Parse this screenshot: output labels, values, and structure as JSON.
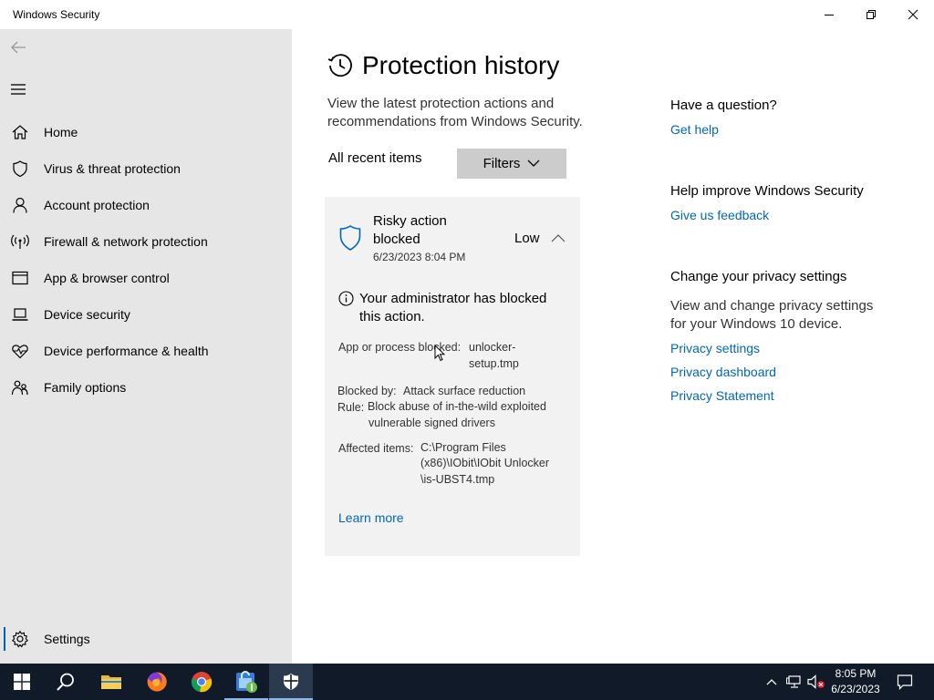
{
  "window": {
    "title": "Windows Security",
    "controls": [
      "minimize",
      "restore",
      "close"
    ]
  },
  "sidebar": {
    "items": [
      {
        "label": "Home",
        "icon": "home-icon"
      },
      {
        "label": "Virus & threat protection",
        "icon": "shield-icon"
      },
      {
        "label": "Account protection",
        "icon": "person-icon"
      },
      {
        "label": "Firewall & network protection",
        "icon": "antenna-icon"
      },
      {
        "label": "App & browser control",
        "icon": "browser-window-icon"
      },
      {
        "label": "Device security",
        "icon": "laptop-icon"
      },
      {
        "label": "Device performance & health",
        "icon": "heart-pulse-icon"
      },
      {
        "label": "Family options",
        "icon": "family-icon"
      }
    ],
    "settings_label": "Settings"
  },
  "main": {
    "title": "Protection history",
    "description": "View the latest protection actions and recommendations from Windows Security.",
    "all_recent_label": "All recent items",
    "filters_label": "Filters",
    "card": {
      "title": "Risky action blocked",
      "date": "6/23/2023 8:04 PM",
      "severity": "Low",
      "message": "Your administrator has blocked this action.",
      "app_key": "App or process blocked:",
      "app_val_1": "unlocker-",
      "app_val_2": "setup.tmp",
      "blocked_by_key": "Blocked by:",
      "blocked_by_val": "Attack surface reduction",
      "rule_key": "Rule:",
      "rule_val_1": "Block abuse of in-the-wild exploited",
      "rule_val_2": "vulnerable signed drivers",
      "affected_key": "Affected items:",
      "affected_val_1": "C:\\Program Files",
      "affected_val_2": "(x86)\\IObit\\IObit Unlocker",
      "affected_val_3": "\\is-UBST4.tmp",
      "learn_more": "Learn more"
    }
  },
  "right": {
    "question_heading": "Have a question?",
    "get_help": "Get help",
    "improve_heading": "Help improve Windows Security",
    "feedback": "Give us feedback",
    "privacy_heading": "Change your privacy settings",
    "privacy_desc": "View and change privacy settings for your Windows 10 device.",
    "privacy_settings": "Privacy settings",
    "privacy_dashboard": "Privacy dashboard",
    "privacy_statement": "Privacy Statement"
  },
  "taskbar": {
    "apps": [
      "start-icon",
      "search-icon",
      "file-explorer-icon",
      "firefox-icon",
      "chrome-icon",
      "iobit-unlocker-icon",
      "windows-security-icon"
    ],
    "time": "8:05 PM",
    "date": "6/23/2023"
  },
  "colors": {
    "accent": "#0067b8",
    "sidebar_bg": "#e6e6e6",
    "taskbar_bg": "#101a28"
  }
}
